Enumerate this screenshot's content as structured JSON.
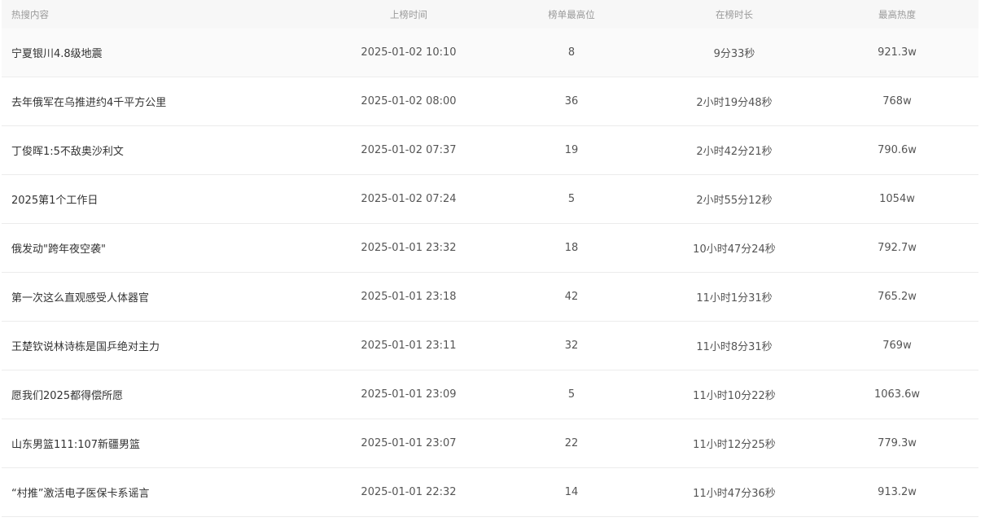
{
  "table": {
    "headers": {
      "title": "热搜内容",
      "time": "上榜时间",
      "rank": "榜单最高位",
      "duration": "在榜时长",
      "heat": "最高热度"
    },
    "rows": [
      {
        "title": "宁夏银川4.8级地震",
        "time": "2025-01-02 10:10",
        "rank": "8",
        "duration": "9分33秒",
        "heat": "921.3w"
      },
      {
        "title": "去年俄军在乌推进约4千平方公里",
        "time": "2025-01-02 08:00",
        "rank": "36",
        "duration": "2小时19分48秒",
        "heat": "768w"
      },
      {
        "title": "丁俊晖1:5不敌奥沙利文",
        "time": "2025-01-02 07:37",
        "rank": "19",
        "duration": "2小时42分21秒",
        "heat": "790.6w"
      },
      {
        "title": "2025第1个工作日",
        "time": "2025-01-02 07:24",
        "rank": "5",
        "duration": "2小时55分12秒",
        "heat": "1054w"
      },
      {
        "title": "俄发动\"跨年夜空袭\"",
        "time": "2025-01-01 23:32",
        "rank": "18",
        "duration": "10小时47分24秒",
        "heat": "792.7w"
      },
      {
        "title": "第一次这么直观感受人体器官",
        "time": "2025-01-01 23:18",
        "rank": "42",
        "duration": "11小时1分31秒",
        "heat": "765.2w"
      },
      {
        "title": "王楚钦说林诗栋是国乒绝对主力",
        "time": "2025-01-01 23:11",
        "rank": "32",
        "duration": "11小时8分31秒",
        "heat": "769w"
      },
      {
        "title": "愿我们2025都得偿所愿",
        "time": "2025-01-01 23:09",
        "rank": "5",
        "duration": "11小时10分22秒",
        "heat": "1063.6w"
      },
      {
        "title": "山东男篮111:107新疆男篮",
        "time": "2025-01-01 23:07",
        "rank": "22",
        "duration": "11小时12分25秒",
        "heat": "779.3w"
      },
      {
        "title": "“村推”激活电子医保卡系谣言",
        "time": "2025-01-01 22:32",
        "rank": "14",
        "duration": "11小时47分36秒",
        "heat": "913.2w"
      }
    ]
  }
}
